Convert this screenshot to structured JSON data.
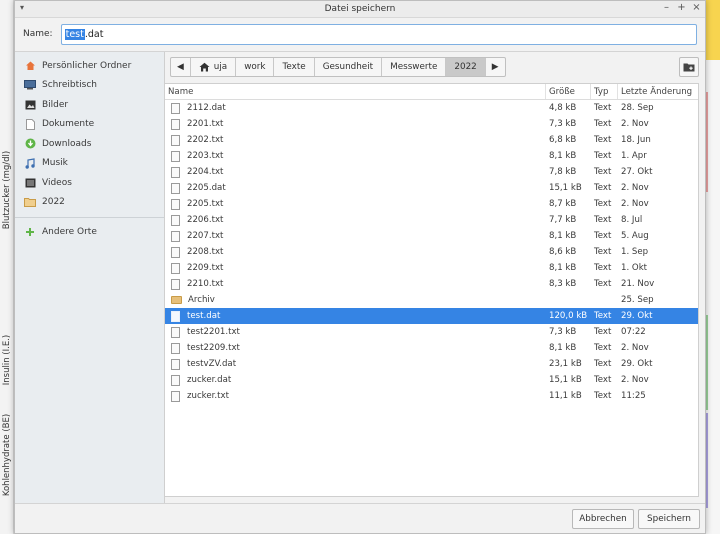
{
  "background": {
    "vertical_labels": [
      "Blutzucker (mg/dl)",
      "Insulin (I.E.)",
      "Kohlenhydrate (BE)"
    ]
  },
  "dialog": {
    "title": "Datei speichern",
    "name_label": "Name:",
    "filename_selected": "test",
    "filename_rest": ".dat"
  },
  "sidebar": {
    "items": [
      {
        "label": "Persönlicher Ordner",
        "icon": "home-icon"
      },
      {
        "label": "Schreibtisch",
        "icon": "desktop-icon"
      },
      {
        "label": "Bilder",
        "icon": "pictures-icon"
      },
      {
        "label": "Dokumente",
        "icon": "document-icon"
      },
      {
        "label": "Downloads",
        "icon": "download-icon"
      },
      {
        "label": "Musik",
        "icon": "music-icon"
      },
      {
        "label": "Videos",
        "icon": "video-icon"
      },
      {
        "label": "2022",
        "icon": "folder-icon"
      }
    ],
    "other": {
      "label": "Andere Orte",
      "icon": "plus-icon"
    }
  },
  "pathbar": {
    "crumbs": [
      "uja",
      "work",
      "Texte",
      "Gesundheit",
      "Messwerte",
      "2022"
    ],
    "active": "2022"
  },
  "columns": {
    "name": "Name",
    "size": "Größe",
    "type": "Typ",
    "date": "Letzte Änderung"
  },
  "files": [
    {
      "name": "2112.dat",
      "size": "4,8 kB",
      "type": "Text",
      "date": "28. Sep"
    },
    {
      "name": "2201.txt",
      "size": "7,3 kB",
      "type": "Text",
      "date": "2. Nov"
    },
    {
      "name": "2202.txt",
      "size": "6,8 kB",
      "type": "Text",
      "date": "18. Jun"
    },
    {
      "name": "2203.txt",
      "size": "8,1 kB",
      "type": "Text",
      "date": "1. Apr"
    },
    {
      "name": "2204.txt",
      "size": "7,8 kB",
      "type": "Text",
      "date": "27. Okt"
    },
    {
      "name": "2205.dat",
      "size": "15,1 kB",
      "type": "Text",
      "date": "2. Nov"
    },
    {
      "name": "2205.txt",
      "size": "8,7 kB",
      "type": "Text",
      "date": "2. Nov"
    },
    {
      "name": "2206.txt",
      "size": "7,7 kB",
      "type": "Text",
      "date": "8. Jul"
    },
    {
      "name": "2207.txt",
      "size": "8,1 kB",
      "type": "Text",
      "date": "5. Aug"
    },
    {
      "name": "2208.txt",
      "size": "8,6 kB",
      "type": "Text",
      "date": "1. Sep"
    },
    {
      "name": "2209.txt",
      "size": "8,1 kB",
      "type": "Text",
      "date": "1. Okt"
    },
    {
      "name": "2210.txt",
      "size": "8,3 kB",
      "type": "Text",
      "date": "21. Nov"
    },
    {
      "name": "Archiv",
      "size": "",
      "type": "",
      "date": "25. Sep",
      "folder": true
    },
    {
      "name": "test.dat",
      "size": "120,0 kB",
      "type": "Text",
      "date": "29. Okt",
      "selected": true
    },
    {
      "name": "test2201.txt",
      "size": "7,3 kB",
      "type": "Text",
      "date": "07:22"
    },
    {
      "name": "test2209.txt",
      "size": "8,1 kB",
      "type": "Text",
      "date": "2. Nov"
    },
    {
      "name": "testvZV.dat",
      "size": "23,1 kB",
      "type": "Text",
      "date": "29. Okt"
    },
    {
      "name": "zucker.dat",
      "size": "15,1 kB",
      "type": "Text",
      "date": "2. Nov"
    },
    {
      "name": "zucker.txt",
      "size": "11,1 kB",
      "type": "Text",
      "date": "11:25"
    }
  ],
  "buttons": {
    "cancel": "Abbrechen",
    "save": "Speichern"
  },
  "colors": {
    "accent": "#3584e4",
    "sidebar_bg": "#e9edf0"
  }
}
